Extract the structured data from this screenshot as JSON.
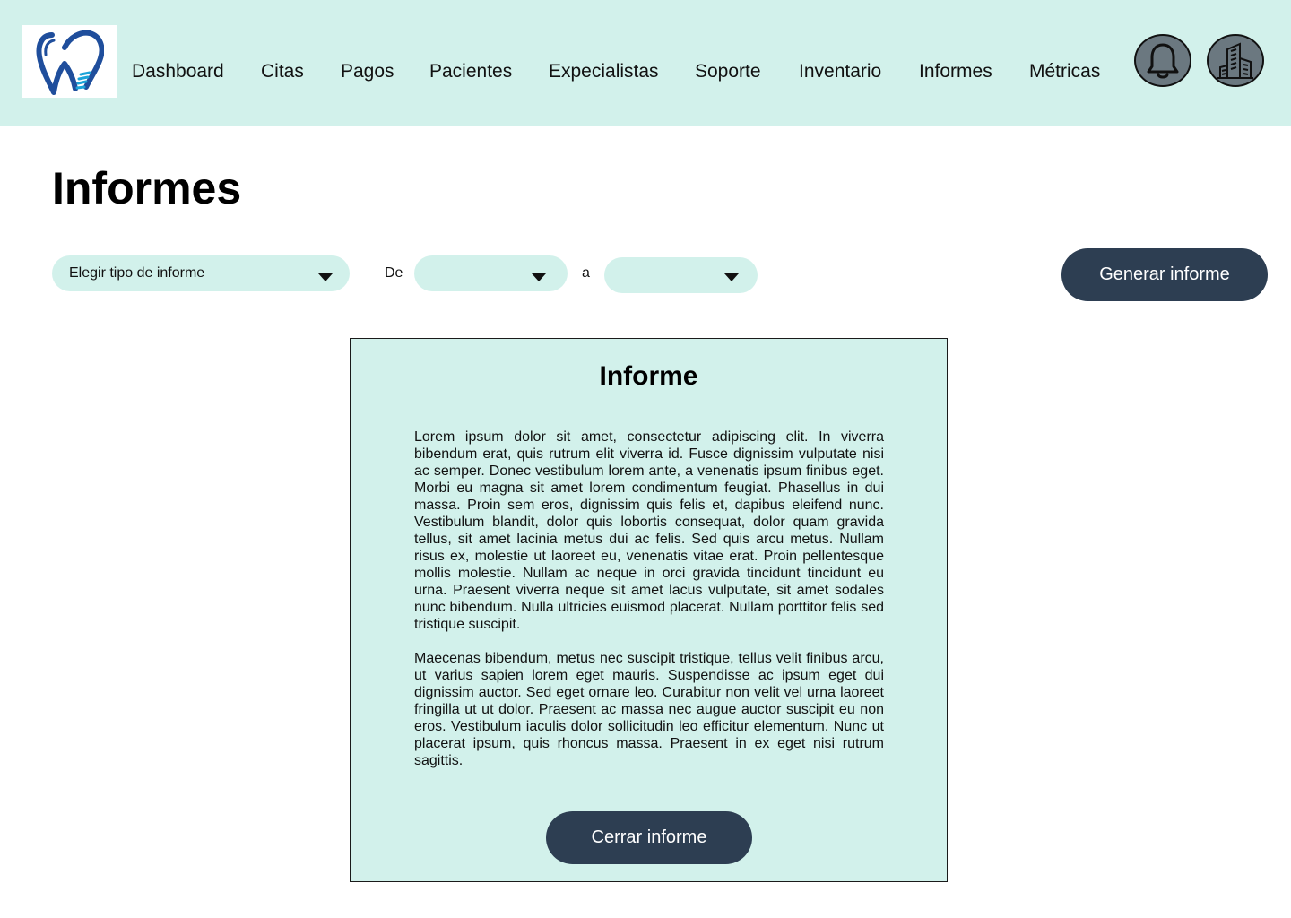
{
  "nav": {
    "items": [
      "Dashboard",
      "Citas",
      "Pagos",
      "Pacientes",
      "Expecialistas",
      "Soporte",
      "Inventario",
      "Informes",
      "Métricas"
    ]
  },
  "icons": {
    "logo": "tooth-logo",
    "notifications": "bell-icon",
    "clinic": "buildings-icon"
  },
  "page": {
    "title": "Informes"
  },
  "filters": {
    "report_type_placeholder": "Elegir tipo de informe",
    "from_label": "De",
    "from_value": "",
    "to_label": "a",
    "to_value": ""
  },
  "actions": {
    "generate": "Generar informe"
  },
  "report": {
    "title": "Informe",
    "paragraphs": [
      "Lorem ipsum dolor sit amet, consectetur adipiscing elit. In viverra bibendum erat, quis rutrum elit viverra id. Fusce dignissim vulputate nisi ac semper. Donec vestibulum lorem ante, a venenatis ipsum finibus eget. Morbi eu magna sit amet lorem condimentum feugiat. Phasellus in dui massa. Proin sem eros, dignissim quis felis et, dapibus eleifend nunc. Vestibulum blandit, dolor quis lobortis consequat, dolor quam gravida tellus, sit amet lacinia metus dui ac felis. Sed quis arcu metus. Nullam risus ex, molestie ut laoreet eu, venenatis vitae erat. Proin pellentesque mollis molestie. Nullam ac neque in orci gravida tincidunt tincidunt eu urna. Praesent viverra neque sit amet lacus vulputate, sit amet sodales nunc bibendum. Nulla ultricies euismod placerat. Nullam porttitor felis sed tristique suscipit.",
      "Maecenas bibendum, metus nec suscipit tristique, tellus velit finibus arcu, ut varius sapien lorem eget mauris. Suspendisse ac ipsum eget dui dignissim auctor. Sed eget ornare leo. Curabitur non velit vel urna laoreet fringilla ut ut dolor. Praesent ac massa nec augue auctor suscipit eu non eros. Vestibulum iaculis dolor sollicitudin leo efficitur elementum. Nunc ut placerat ipsum, quis rhoncus massa. Praesent in ex eget nisi rutrum sagittis."
    ],
    "close": "Cerrar informe"
  },
  "colors": {
    "header_bg": "#d2f1eb",
    "primary_button": "#2d3e52",
    "icon_button_bg": "#6b7880",
    "logo_blue": "#1f4e9c",
    "logo_accent": "#1aa3d8"
  }
}
